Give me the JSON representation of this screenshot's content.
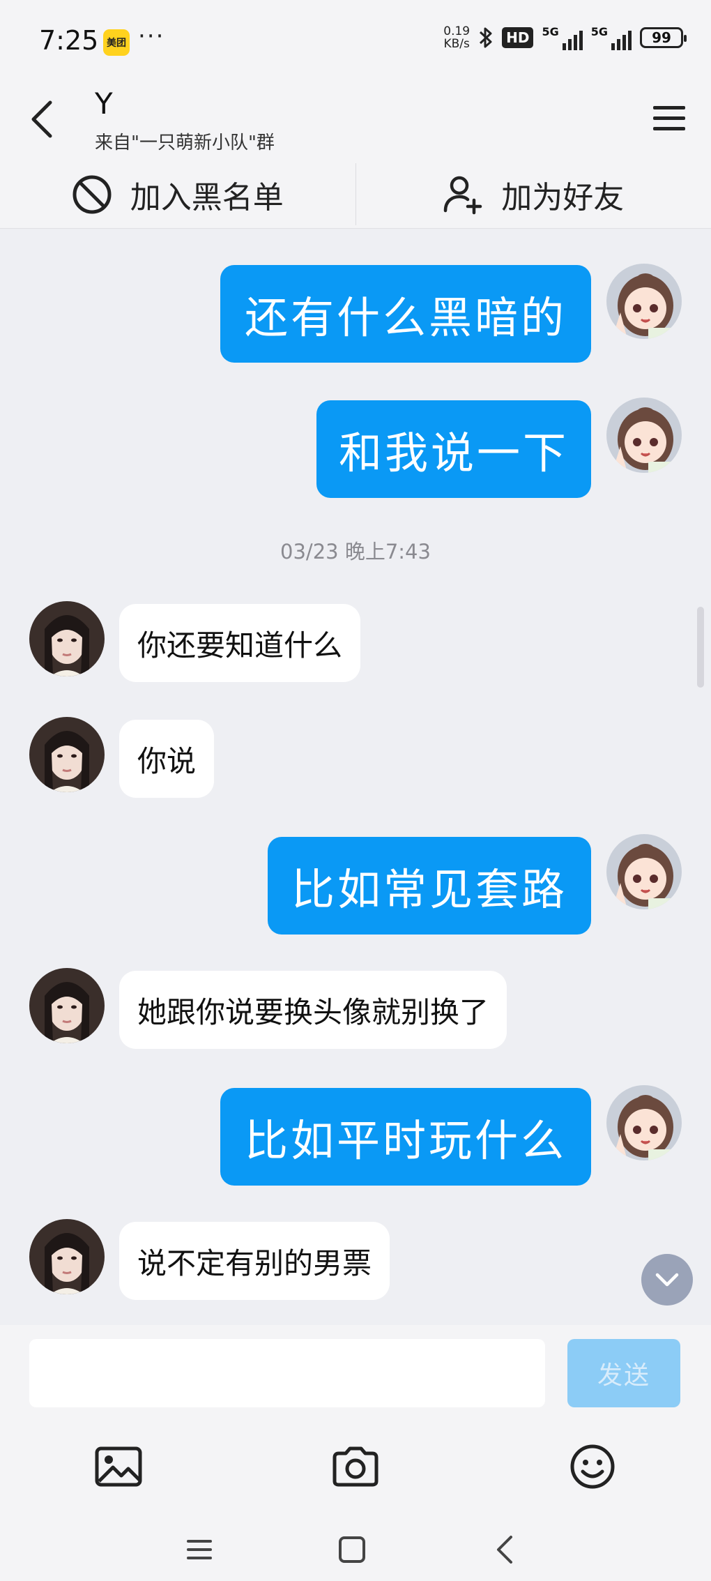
{
  "status_bar": {
    "time": "7:25",
    "app_badge": "美团",
    "dots": "···",
    "speed_value": "0.19",
    "speed_unit": "KB/s",
    "hd_label": "HD",
    "net1_label": "5G",
    "net2_label": "5G",
    "battery": "99"
  },
  "header": {
    "title": "Y",
    "subtitle": "来自\"一只萌新小队\"群"
  },
  "actions": {
    "block_label": "加入黑名单",
    "add_friend_label": "加为好友"
  },
  "messages": [
    {
      "side": "out",
      "text": "还有什么黑暗的"
    },
    {
      "side": "out",
      "text": "和我说一下"
    },
    {
      "side": "timestamp",
      "text": "03/23 晚上7:43"
    },
    {
      "side": "in",
      "text": "你还要知道什么"
    },
    {
      "side": "in",
      "text": "你说"
    },
    {
      "side": "out",
      "text": "比如常见套路"
    },
    {
      "side": "in",
      "text": "她跟你说要换头像就别换了"
    },
    {
      "side": "out",
      "text": "比如平时玩什么"
    },
    {
      "side": "in",
      "text": "说不定有别的男票"
    }
  ],
  "input": {
    "value": "",
    "send_label": "发送"
  },
  "colors": {
    "outgoing_bubble": "#0a99f5",
    "incoming_bubble": "#ffffff",
    "background": "#eeeff3",
    "send_disabled": "#8cccf6"
  },
  "icons": {
    "back": "chevron-left-icon",
    "menu": "hamburger-menu-icon",
    "block": "block-icon",
    "add_friend": "add-user-icon",
    "image": "image-icon",
    "camera": "camera-icon",
    "emoji": "emoji-icon",
    "scroll_down": "chevron-down-icon"
  }
}
